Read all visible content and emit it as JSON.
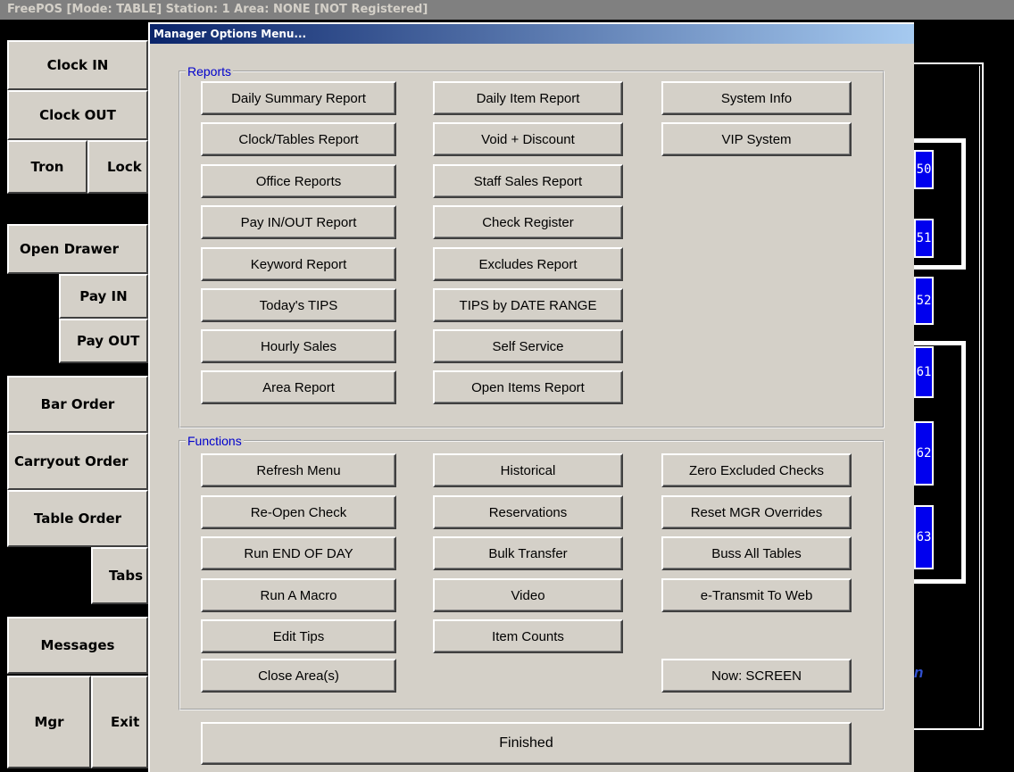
{
  "app": {
    "window_title": "FreePOS [Mode: TABLE] Station: 1 Area: NONE [NOT Registered]"
  },
  "left_buttons": {
    "clock_in": "Clock IN",
    "clock_out": "Clock OUT",
    "tron": "Tron",
    "lock": "Lock",
    "open_drawer": "Open Drawer",
    "pay_in": "Pay IN",
    "pay_out": "Pay OUT",
    "bar_order": "Bar Order",
    "carryout_order": "Carryout Order",
    "table_order": "Table Order",
    "tabs": "Tabs",
    "messages": "Messages",
    "mgr": "Mgr",
    "exit": "Exit"
  },
  "tables": [
    "50",
    "51",
    "52",
    "61",
    "62",
    "63"
  ],
  "background_partial_text": "n",
  "dialog": {
    "title": "Manager Options Menu...",
    "reports_legend": "Reports",
    "reports": {
      "col1": [
        "Daily Summary Report",
        "Clock/Tables Report",
        "Office Reports",
        "Pay IN/OUT Report",
        "Keyword Report",
        "Today's TIPS",
        "Hourly Sales",
        "Area Report"
      ],
      "col2": [
        "Daily Item Report",
        "Void + Discount",
        "Staff Sales Report",
        "Check Register",
        "Excludes Report",
        "TIPS by DATE RANGE",
        "Self Service",
        "Open Items Report"
      ],
      "col3": [
        "System Info",
        "VIP System"
      ]
    },
    "functions_legend": "Functions",
    "functions": {
      "col1": [
        "Refresh Menu",
        "Re-Open Check",
        "Run END OF DAY",
        "Run A Macro",
        "Edit Tips",
        "Close Area(s)"
      ],
      "col2": [
        "Historical",
        "Reservations",
        "Bulk Transfer",
        "Video",
        "Item Counts"
      ],
      "col3": [
        "Zero Excluded Checks",
        "Reset MGR Overrides",
        "Buss All Tables",
        "e-Transmit To Web"
      ],
      "now_screen": "Now: SCREEN"
    },
    "finished": "Finished"
  },
  "colors": {
    "dialog_bg": "#d4d0c8",
    "title_gradient_start": "#0a246a",
    "legend_text": "#0000cc",
    "table_fill": "#0000ee"
  }
}
